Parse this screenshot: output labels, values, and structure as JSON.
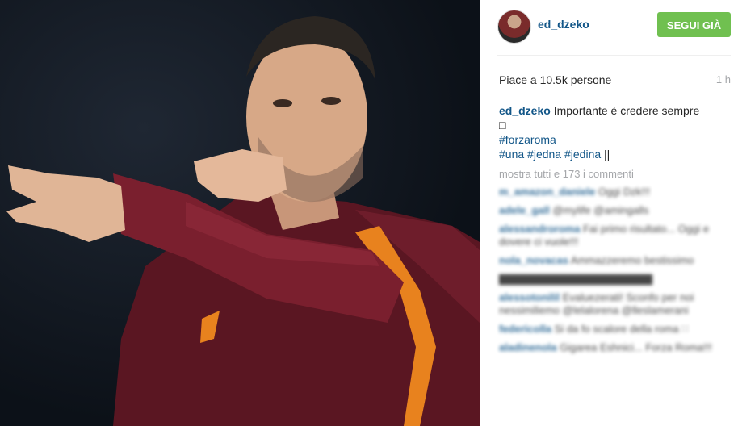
{
  "post": {
    "username": "ed_dzeko",
    "follow_label": "SEGUI GIÀ",
    "likes": "Piace a 10.5k persone",
    "time": "1 h",
    "caption_user": "ed_dzeko",
    "caption_text": "Importante è credere sempre",
    "caption_emoji": "□",
    "hashtag1": "#forzaroma",
    "hashtag2": "#una",
    "hashtag3": "#jedna",
    "hashtag4": "#jedina",
    "caption_tail": "||",
    "show_all_comments": "mostra tutti e 173 i commenti"
  },
  "colors": {
    "accent": "#125688",
    "follow_bg": "#70c050",
    "kit_red": "#7a1f2e",
    "kit_orange": "#e8821e"
  }
}
